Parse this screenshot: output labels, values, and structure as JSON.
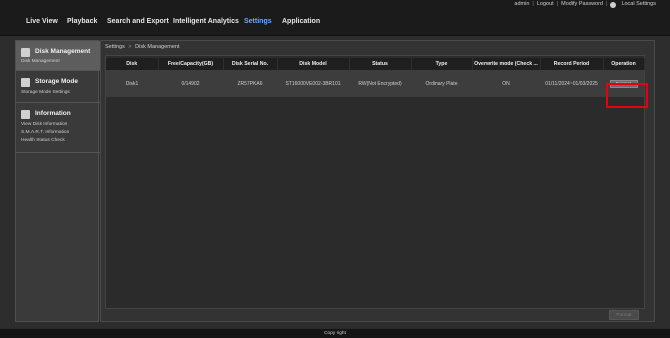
{
  "top_links": {
    "user": "admin",
    "logout": "Logout",
    "modify_password": "Modify Password",
    "local_settings": "Local Settings"
  },
  "nav": {
    "items": [
      "Live View",
      "Playback",
      "Search and Export",
      "Intelligent Analytics",
      "Settings",
      "Application"
    ],
    "active": "Settings"
  },
  "sidebar": {
    "sections": [
      {
        "title": "Disk Management",
        "subs": [
          "Disk Management"
        ]
      },
      {
        "title": "Storage Mode",
        "subs": [
          "Storage Mode Settings"
        ]
      },
      {
        "title": "Information",
        "subs": [
          "View Disk Information",
          "S.M.A.R.T. Information",
          "Health Status Check"
        ]
      }
    ]
  },
  "breadcrumb": {
    "root": "Settings",
    "separator": ">",
    "current": "Disk Management"
  },
  "table": {
    "headers": [
      "Disk",
      "Free/Capacity(GB)",
      "Disk Serial No.",
      "Disk Model",
      "Status",
      "Type",
      "Overwrite mode (Check ...",
      "Record Period",
      "Operation"
    ],
    "rows": [
      [
        "Disk1",
        "0/14902",
        "ZR57PKA6",
        "ST16000VE002-3BR101",
        "RW(Not Encrypted)",
        "Ordinary Plate",
        "ON",
        "01/11/2024~01/03/2025",
        "Format"
      ]
    ]
  },
  "bottom_button": "Format",
  "footer": "Copy right",
  "colors": {
    "accent": "#4a8fe8",
    "highlight": "#e60012"
  }
}
